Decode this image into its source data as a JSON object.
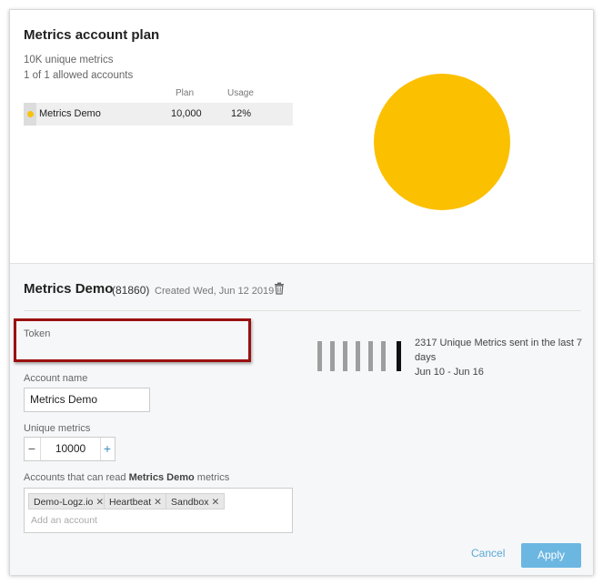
{
  "plan": {
    "title": "Metrics account plan",
    "unique_metrics": "10K unique metrics",
    "allowed_accounts": "1 of 1 allowed accounts",
    "columns": [
      "Plan",
      "Usage"
    ],
    "rows": [
      {
        "name": "Metrics Demo",
        "plan": "10,000",
        "usage": "12%"
      }
    ],
    "pie_color": "#fbc000"
  },
  "account": {
    "name": "Metrics Demo",
    "id": "(81860)",
    "created": "Created Wed, Jun 12 2019",
    "token_label": "Token",
    "account_name_label": "Account name",
    "account_name_value": "Metrics Demo",
    "unique_metrics_label": "Unique metrics",
    "unique_metrics_value": "10000",
    "stepper_minus": "−",
    "stepper_plus": "+",
    "readers_label_prefix": "Accounts that can read ",
    "readers_label_bold": "Metrics Demo",
    "readers_label_suffix": " metrics",
    "readers": [
      "Demo-Logz.io",
      "Heartbeat",
      "Sandbox"
    ],
    "add_placeholder": "Add an account",
    "stat_line1": "2317 Unique Metrics sent in the last 7 days",
    "stat_line2": "Jun 10 - Jun 16",
    "bar_levels": [
      1,
      1,
      1,
      1,
      1,
      1,
      1
    ],
    "highlight_color": "#9b1010"
  },
  "actions": {
    "cancel": "Cancel",
    "apply": "Apply"
  }
}
